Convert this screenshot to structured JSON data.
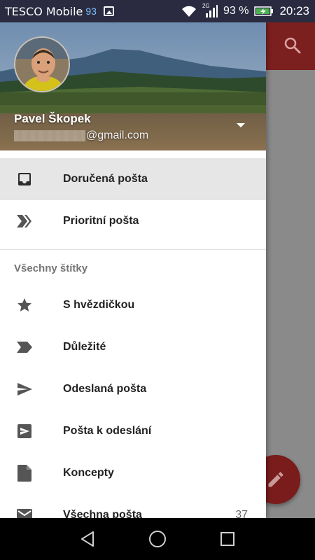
{
  "status_bar": {
    "carrier": "TESCO Mobile",
    "signal_badge": "93",
    "network_type": "2G",
    "battery_percent": "93 %",
    "time": "20:23",
    "icons": [
      "image-icon",
      "wifi-icon",
      "signal-icon",
      "battery-charging-icon"
    ]
  },
  "account": {
    "name": "Pavel Škopek",
    "email_domain": "@gmail.com"
  },
  "nav_items": [
    {
      "label": "Doručená pošta",
      "icon": "inbox-icon",
      "active": true
    },
    {
      "label": "Prioritní pošta",
      "icon": "priority-icon",
      "active": false
    }
  ],
  "labels_section": {
    "title": "Všechny štítky",
    "items": [
      {
        "label": "S hvězdičkou",
        "icon": "star-icon"
      },
      {
        "label": "Důležité",
        "icon": "important-icon"
      },
      {
        "label": "Odeslaná pošta",
        "icon": "send-icon"
      },
      {
        "label": "Pošta k odeslání",
        "icon": "outbox-icon"
      },
      {
        "label": "Koncepty",
        "icon": "draft-icon"
      },
      {
        "label": "Všechna pošta",
        "icon": "mail-icon",
        "count": "37"
      }
    ]
  },
  "background_app": {
    "search_icon": "search-icon",
    "compose_icon": "pencil-icon",
    "accent_color": "#7c1f1f"
  },
  "system_nav": [
    "back-icon",
    "home-icon",
    "recents-icon"
  ]
}
